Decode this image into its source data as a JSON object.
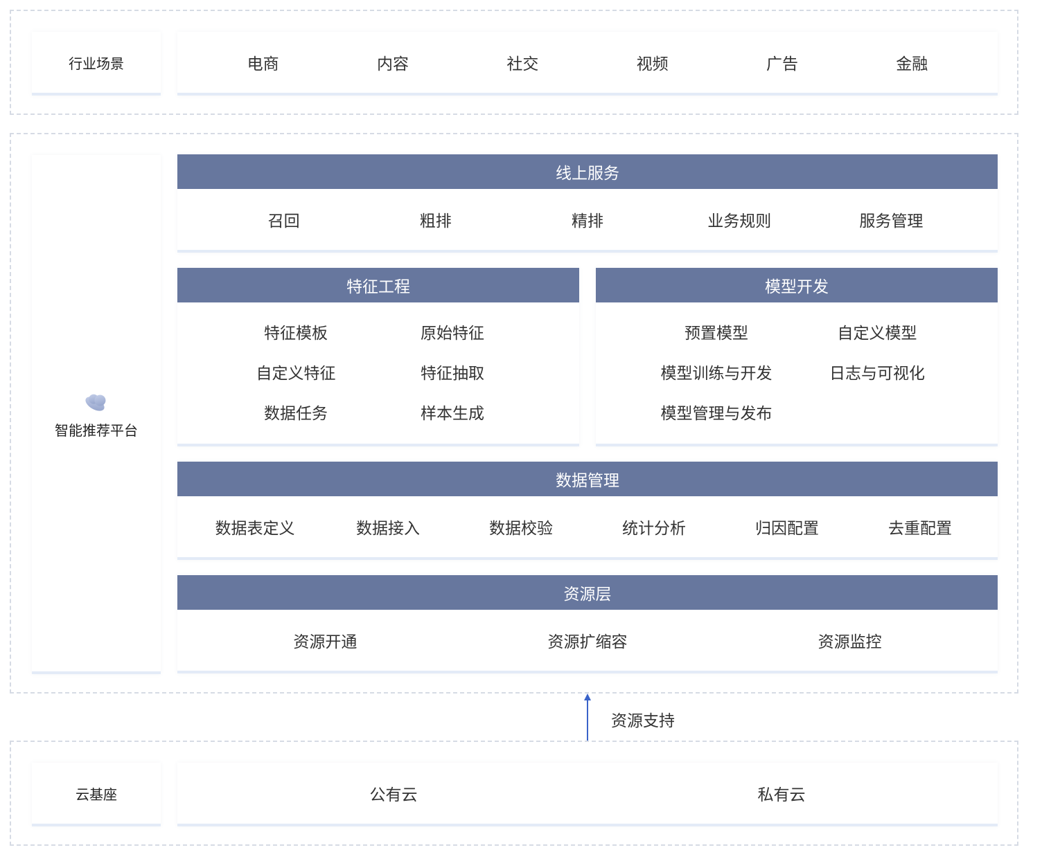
{
  "industry": {
    "label": "行业场景",
    "items": [
      "电商",
      "内容",
      "社交",
      "视频",
      "广告",
      "金融"
    ]
  },
  "platform": {
    "label": "智能推荐平台",
    "icon": "cloud-icon",
    "online_service": {
      "title": "线上服务",
      "items": [
        "召回",
        "粗排",
        "精排",
        "业务规则",
        "服务管理"
      ]
    },
    "feature_engineering": {
      "title": "特征工程",
      "items": [
        "特征模板",
        "原始特征",
        "自定义特征",
        "特征抽取",
        "数据任务",
        "样本生成"
      ]
    },
    "model_development": {
      "title": "模型开发",
      "items": [
        "预置模型",
        "自定义模型",
        "模型训练与开发",
        "日志与可视化",
        "模型管理与发布"
      ]
    },
    "data_management": {
      "title": "数据管理",
      "items": [
        "数据表定义",
        "数据接入",
        "数据校验",
        "统计分析",
        "归因配置",
        "去重配置"
      ]
    },
    "resource_layer": {
      "title": "资源层",
      "items": [
        "资源开通",
        "资源扩缩容",
        "资源监控"
      ]
    }
  },
  "support": {
    "label": "资源支持",
    "arrow_color": "#3a63c9"
  },
  "cloud_base": {
    "label": "云基座",
    "items": [
      "公有云",
      "私有云"
    ]
  },
  "colors": {
    "header": "#67779e",
    "frame": "#d6dbe4",
    "card_border": "#e3ebf7"
  }
}
